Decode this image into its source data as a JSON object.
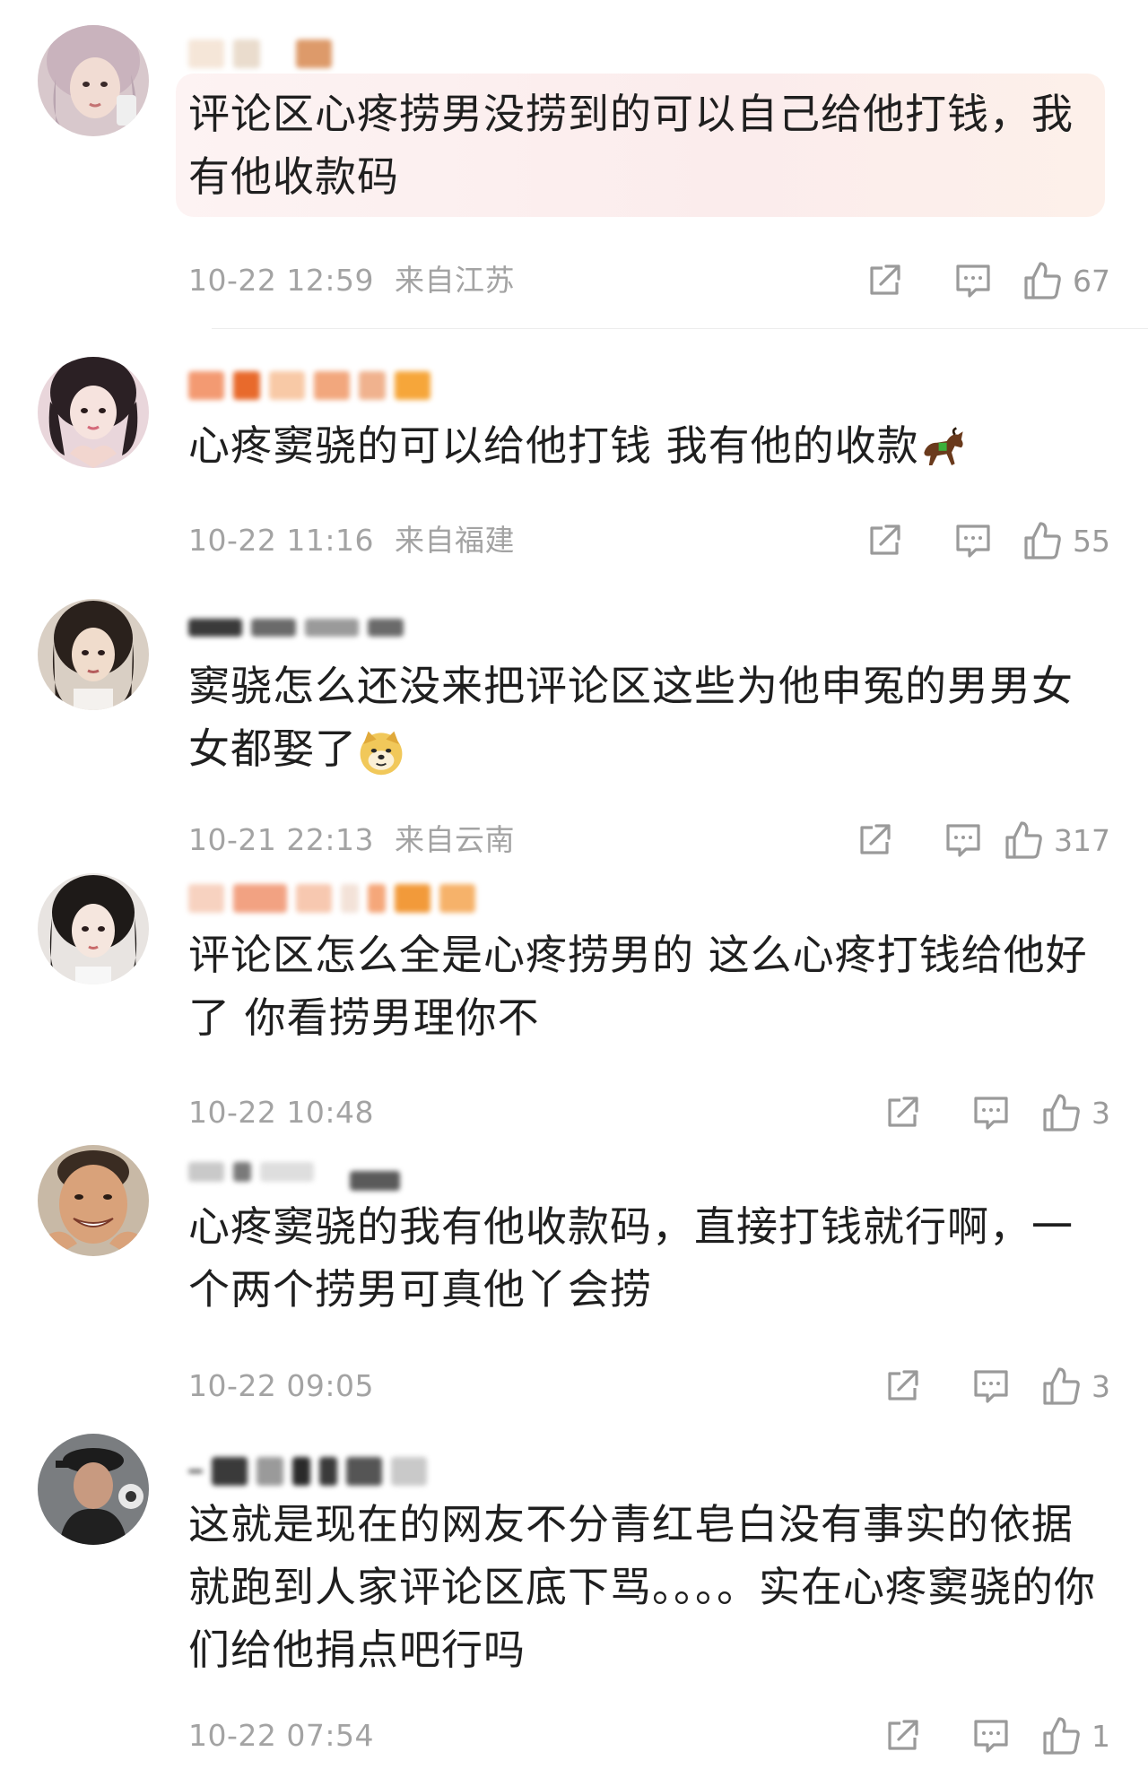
{
  "comments": [
    {
      "text": "评论区心疼捞男没捞到的可以自己给他打钱，我有他收款码",
      "timestamp": "10-22 12:59",
      "location": "来自江苏",
      "likes": "67",
      "avatar_icon": "avatar-girl-pink-hair",
      "highlighted": true
    },
    {
      "text": "心疼窦骁的可以给他打钱 我有他的收款",
      "emoji": "horse-emoji",
      "timestamp": "10-22 11:16",
      "location": "来自福建",
      "likes": "55",
      "avatar_icon": "avatar-girl-heart-hands"
    },
    {
      "text": "窦骁怎么还没来把评论区这些为他申冤的男男女女都娶了",
      "emoji": "doge-emoji",
      "timestamp": "10-21 22:13",
      "location": "来自云南",
      "likes": "317",
      "avatar_icon": "avatar-woman-dark-hair"
    },
    {
      "text": "评论区怎么全是心疼捞男的 这么心疼打钱给他好了 你看捞男理你不",
      "timestamp": "10-22 10:48",
      "location": "",
      "likes": "3",
      "avatar_icon": "avatar-girl-long-hair"
    },
    {
      "text": "心疼窦骁的我有他收款码，直接打钱就行啊，一个两个捞男可真他丫会捞",
      "timestamp": "10-22 09:05",
      "location": "",
      "likes": "3",
      "avatar_icon": "avatar-man-smiling"
    },
    {
      "text": "这就是现在的网友不分青红皂白没有事实的依据就跑到人家评论区底下骂。。。。实在心疼窦骁的你们给他捐点吧行吗",
      "timestamp": "10-22 07:54",
      "location": "",
      "likes": "1",
      "avatar_icon": "avatar-man-cap"
    }
  ],
  "colors": {
    "text": "#1f1f1f",
    "meta": "#a3a3a3",
    "icon": "#9a9a9a",
    "highlight": "#fbecec"
  },
  "icons": [
    "share-icon",
    "comment-icon",
    "like-icon"
  ]
}
